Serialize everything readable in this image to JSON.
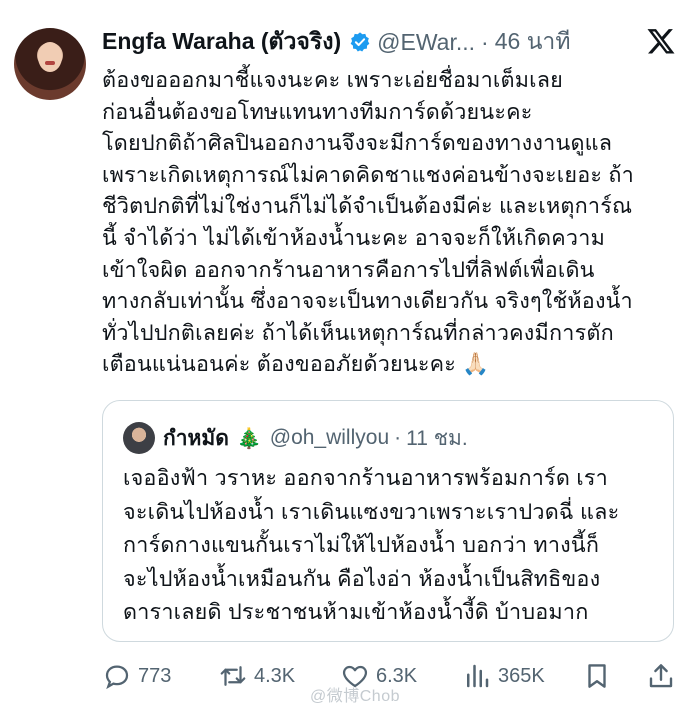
{
  "author": {
    "name": "Engfa Waraha (ตัวจริง)",
    "handle": "@EWar...",
    "separator": "·",
    "time": "46 นาที",
    "verified_color": "#1d9bf0"
  },
  "tweet_text": [
    "ต้องขอออกมาชี้แจงนะคะ เพราะเอ่ยชื่อมาเต็มเลย",
    "ก่อนอื่นต้องขอโทษแทนทางทีมการ์ดด้วยนะคะ",
    "โดยปกติถ้าศิลปินออกงานจึงจะมีการ์ดของทางงานดูแล",
    "เพราะเกิดเหตุการณ์ไม่คาดคิดชาแชงค่อนข้างจะเยอะ ถ้า",
    "ชีวิตปกติที่ไม่ใช่งานก็ไม่ได้จำเป็นต้องมีค่ะ และเหตุการ์ณ",
    "นี้ จำได้ว่า ไม่ได้เข้าห้องน้ำนะคะ อาจจะก็ให้เกิดความ",
    "เข้าใจผิด  ออกจากร้านอาหารคือการไปที่ลิฟต์เพื่อเดิน",
    "ทางกลับเท่านั้น ซึ่งอาจจะเป็นทางเดียวกัน จริงๆใช้ห้องน้ำ",
    "ทั่วไปปกติเลยค่ะ  ถ้าได้เห็นเหตุการ์ณที่กล่าวคงมีการตัก",
    "เตือนแน่นอนค่ะ ต้องขออภัยด้วยนะคะ 🙏🏻"
  ],
  "quoted": {
    "name": "กำหมัด",
    "emoji": "🎄",
    "handle": "@oh_willyou",
    "separator": "·",
    "time": "11 ชม.",
    "text": [
      "เจออิงฟ้า วราหะ ออกจากร้านอาหารพร้อมการ์ด เรา",
      "จะเดินไปห้องน้ำ เราเดินแซงขวาเพราะเราปวดฉี่ และ",
      "การ์ดกางแขนกั้นเราไม่ให้ไปห้องน้ำ บอกว่า ทางนี้ก็",
      "จะไปห้องน้ำเหมือนกัน คือไงอ่า ห้องน้ำเป็นสิทธิของ",
      "ดาราเลยดิ ประชาชนห้ามเข้าห้องน้ำงี้ดิ บ้าบอมาก"
    ]
  },
  "actions": {
    "replies": "773",
    "retweets": "4.3K",
    "likes": "6.3K",
    "views": "365K"
  },
  "watermark": "@微博Chob",
  "icons": [
    "verified-icon",
    "x-logo-icon",
    "reply-icon",
    "retweet-icon",
    "like-icon",
    "views-icon",
    "bookmark-icon",
    "share-icon"
  ]
}
